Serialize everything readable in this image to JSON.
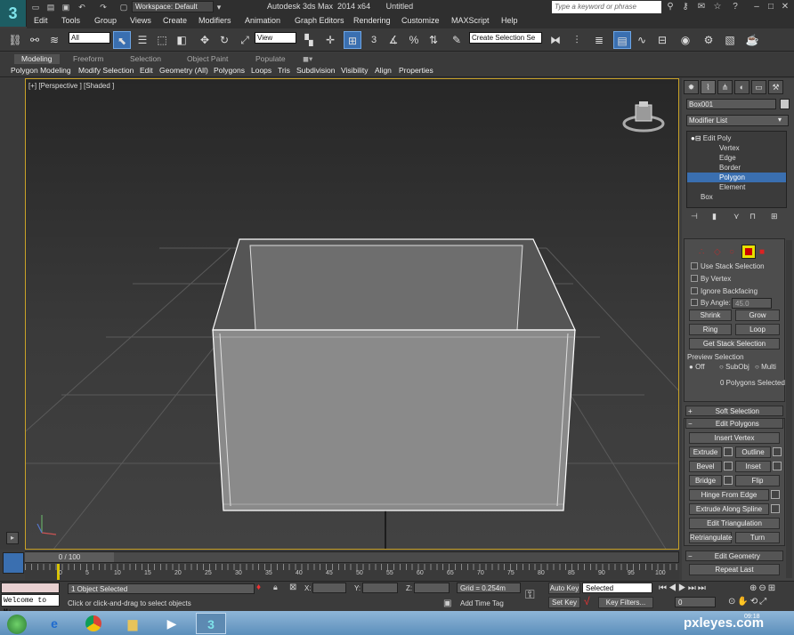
{
  "title_bar": {
    "app_logo": "3",
    "workspace": "Workspace: Default",
    "window_title": "Autodesk 3ds Max  2014 x64       Untitled",
    "search_placeholder": "Type a keyword or phrase"
  },
  "menu": [
    "Edit",
    "Tools",
    "Group",
    "Views",
    "Create",
    "Modifiers",
    "Animation",
    "Graph Editors",
    "Rendering",
    "Customize",
    "MAXScript",
    "Help"
  ],
  "toolbar": {
    "selection_filter": "All",
    "reference_coord": "View",
    "named_selection": "Create Selection Se",
    "snap_label": "3"
  },
  "ribbon": {
    "tabs": [
      "Modeling",
      "Freeform",
      "Selection",
      "Object Paint",
      "Populate"
    ],
    "active_tab": "Modeling",
    "sub_items": [
      "Polygon Modeling",
      "Modify Selection",
      "Edit",
      "Geometry (All)",
      "Polygons",
      "Loops",
      "Tris",
      "Subdivision",
      "Visibility",
      "Align",
      "Properties"
    ]
  },
  "viewport": {
    "label": "[+] [Perspective ] [Shaded ]"
  },
  "command_panel": {
    "object_name": "Box001",
    "modifier_list": "Modifier List",
    "stack": [
      {
        "label": "Edit Poly",
        "selected": false
      },
      {
        "label": "Vertex",
        "selected": false
      },
      {
        "label": "Edge",
        "selected": false
      },
      {
        "label": "Border",
        "selected": false
      },
      {
        "label": "Polygon",
        "selected": true
      },
      {
        "label": "Element",
        "selected": false
      },
      {
        "label": "Box",
        "selected": false
      }
    ],
    "selection": {
      "use_stack_selection": "Use Stack Selection",
      "by_vertex": "By Vertex",
      "ignore_backfacing": "Ignore Backfacing",
      "by_angle": "By Angle:",
      "angle_value": "45.0",
      "shrink": "Shrink",
      "grow": "Grow",
      "ring": "Ring",
      "loop": "Loop",
      "get_stack_selection": "Get Stack Selection",
      "preview_selection": "Preview Selection",
      "preview_off": "Off",
      "preview_subobj": "SubObj",
      "preview_multi": "Multi",
      "status": "0 Polygons Selected"
    },
    "soft_selection": "Soft Selection",
    "edit_polygons": {
      "header": "Edit Polygons",
      "insert_vertex": "Insert Vertex",
      "extrude": "Extrude",
      "outline": "Outline",
      "bevel": "Bevel",
      "inset": "Inset",
      "bridge": "Bridge",
      "flip": "Flip",
      "hinge_from_edge": "Hinge From Edge",
      "extrude_along_spline": "Extrude Along Spline",
      "edit_triangulation": "Edit Triangulation",
      "retriangulate": "Retriangulate",
      "turn": "Turn"
    },
    "edit_geometry": {
      "header": "Edit Geometry",
      "repeat_last": "Repeat Last"
    }
  },
  "timeline": {
    "frame_counter": "0 / 100",
    "ticks": [
      "0",
      "5",
      "10",
      "15",
      "20",
      "25",
      "30",
      "35",
      "40",
      "45",
      "50",
      "55",
      "60",
      "65",
      "70",
      "75",
      "80",
      "85",
      "90",
      "95",
      "100"
    ]
  },
  "status": {
    "maxscript": "Welcome to M:",
    "selected": "1 Object Selected",
    "prompt": "Click or click-and-drag to select objects",
    "x_label": "X:",
    "y_label": "Y:",
    "z_label": "Z:",
    "grid": "Grid = 0.254m",
    "add_time_tag": "Add Time Tag",
    "auto_key": "Auto Key",
    "set_key": "Set Key",
    "key_mode": "Selected",
    "key_filters": "Key Filters...",
    "frame_value": "0"
  },
  "taskbar": {
    "watermark": "pxleyes.com",
    "clock": "09:18"
  }
}
